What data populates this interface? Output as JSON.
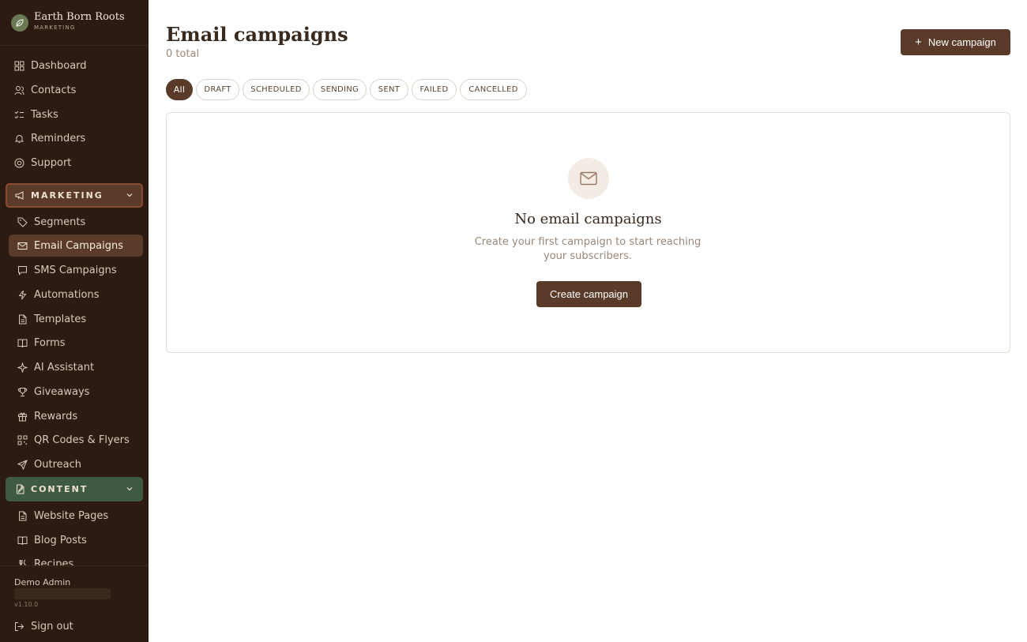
{
  "brand": {
    "name": "Earth Born Roots",
    "subtitle": "MARKETING"
  },
  "sidebar": {
    "top_items": [
      {
        "label": "Dashboard",
        "icon": "grid-icon"
      },
      {
        "label": "Contacts",
        "icon": "users-icon"
      },
      {
        "label": "Tasks",
        "icon": "list-check-icon"
      },
      {
        "label": "Reminders",
        "icon": "bell-icon"
      },
      {
        "label": "Support",
        "icon": "lifebuoy-icon"
      }
    ],
    "marketing": {
      "label": "MARKETING",
      "items": [
        {
          "label": "Segments",
          "icon": "tag-icon"
        },
        {
          "label": "Email Campaigns",
          "icon": "mail-icon",
          "active": true
        },
        {
          "label": "SMS Campaigns",
          "icon": "message-icon"
        },
        {
          "label": "Automations",
          "icon": "zap-icon"
        },
        {
          "label": "Templates",
          "icon": "file-icon"
        },
        {
          "label": "Forms",
          "icon": "book-icon"
        },
        {
          "label": "AI Assistant",
          "icon": "sparkle-icon"
        },
        {
          "label": "Giveaways",
          "icon": "trophy-icon"
        },
        {
          "label": "Rewards",
          "icon": "gift-icon"
        },
        {
          "label": "QR Codes & Flyers",
          "icon": "qr-icon"
        },
        {
          "label": "Outreach",
          "icon": "send-icon"
        }
      ]
    },
    "content": {
      "label": "CONTENT",
      "items": [
        {
          "label": "Website Pages",
          "icon": "file-icon"
        },
        {
          "label": "Blog Posts",
          "icon": "book-icon"
        },
        {
          "label": "Recipes",
          "icon": "utensils-icon"
        }
      ]
    },
    "footer": {
      "user_name": "Demo Admin",
      "version": "v1.10.0",
      "sign_out": "Sign out"
    }
  },
  "main": {
    "title": "Email campaigns",
    "count": "0 total",
    "new_button": "New campaign",
    "filters": [
      "All",
      "DRAFT",
      "SCHEDULED",
      "SENDING",
      "SENT",
      "FAILED",
      "CANCELLED"
    ],
    "active_filter": "All",
    "empty_state": {
      "title": "No email campaigns",
      "description": "Create your first campaign to start reaching your subscribers.",
      "button": "Create campaign"
    }
  },
  "colors": {
    "sidebar_bg": "#2b1b12",
    "accent": "#5a3a28",
    "content_section": "#3f5a43"
  }
}
